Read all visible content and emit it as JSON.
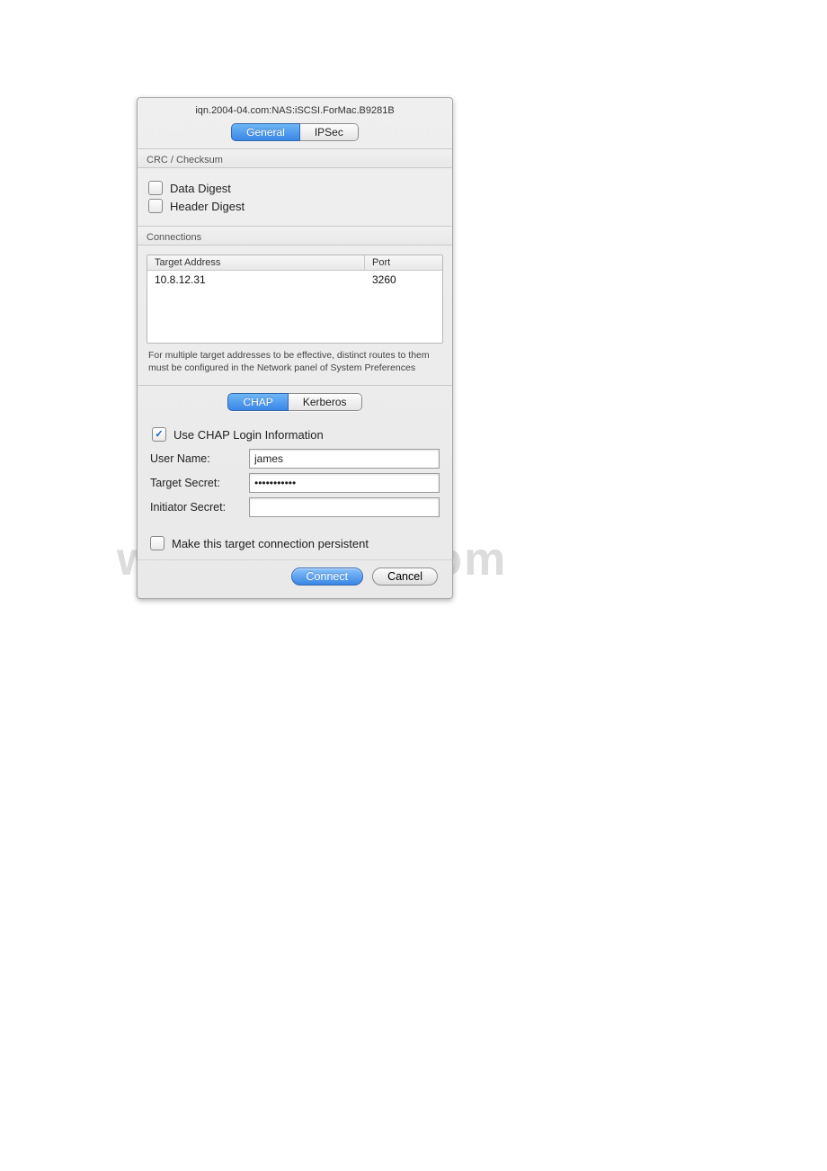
{
  "watermark": "www.bdocx.com",
  "dialog": {
    "title": "iqn.2004-04.com:NAS:iSCSI.ForMac.B9281B",
    "top_tabs": [
      "General",
      "IPSec"
    ],
    "crc_section": {
      "title": "CRC / Checksum",
      "data_digest_label": "Data Digest",
      "header_digest_label": "Header Digest"
    },
    "connections_section": {
      "title": "Connections",
      "columns": [
        "Target Address",
        "Port"
      ],
      "rows": [
        {
          "address": "10.8.12.31",
          "port": "3260"
        }
      ],
      "hint": "For multiple target addresses to be effective, distinct routes to them must be configured in the Network panel of System Preferences"
    },
    "auth_tabs": [
      "CHAP",
      "Kerberos"
    ],
    "chap": {
      "use_chap_label": "Use CHAP Login Information",
      "user_name_label": "User Name:",
      "user_name_value": "james",
      "target_secret_label": "Target Secret:",
      "target_secret_value": "•••••••••••",
      "initiator_secret_label": "Initiator Secret:",
      "initiator_secret_value": ""
    },
    "persistent_label": "Make this target connection persistent",
    "buttons": {
      "connect": "Connect",
      "cancel": "Cancel"
    }
  }
}
